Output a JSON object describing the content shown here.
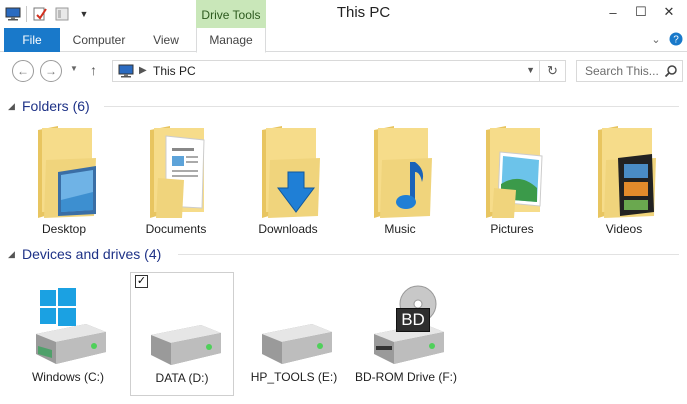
{
  "window": {
    "title": "This PC",
    "context_tab_group": "Drive Tools"
  },
  "ribbon": {
    "tabs": [
      {
        "label": "File"
      },
      {
        "label": "Computer"
      },
      {
        "label": "View"
      },
      {
        "label": "Manage"
      }
    ]
  },
  "navigation": {
    "address": "This PC",
    "search_placeholder": "Search This..."
  },
  "folders_section": {
    "header": "Folders (6)",
    "items": [
      {
        "label": "Desktop",
        "icon": "desktop-folder-icon"
      },
      {
        "label": "Documents",
        "icon": "documents-folder-icon"
      },
      {
        "label": "Downloads",
        "icon": "downloads-folder-icon"
      },
      {
        "label": "Music",
        "icon": "music-folder-icon"
      },
      {
        "label": "Pictures",
        "icon": "pictures-folder-icon"
      },
      {
        "label": "Videos",
        "icon": "videos-folder-icon"
      }
    ]
  },
  "drives_section": {
    "header": "Devices and drives (4)",
    "items": [
      {
        "label": "Windows (C:)",
        "icon": "system-drive-icon"
      },
      {
        "label": "DATA (D:)",
        "icon": "hard-drive-icon",
        "selected": true
      },
      {
        "label": "HP_TOOLS (E:)",
        "icon": "hard-drive-icon"
      },
      {
        "label": "BD-ROM Drive (F:)",
        "icon": "bd-rom-drive-icon",
        "badge": "BD"
      }
    ]
  },
  "colors": {
    "file_tab": "#1979ca",
    "context_tab": "#c9e7b9",
    "section_header": "#1e3287",
    "folder_yellow": "#f0d47c"
  }
}
